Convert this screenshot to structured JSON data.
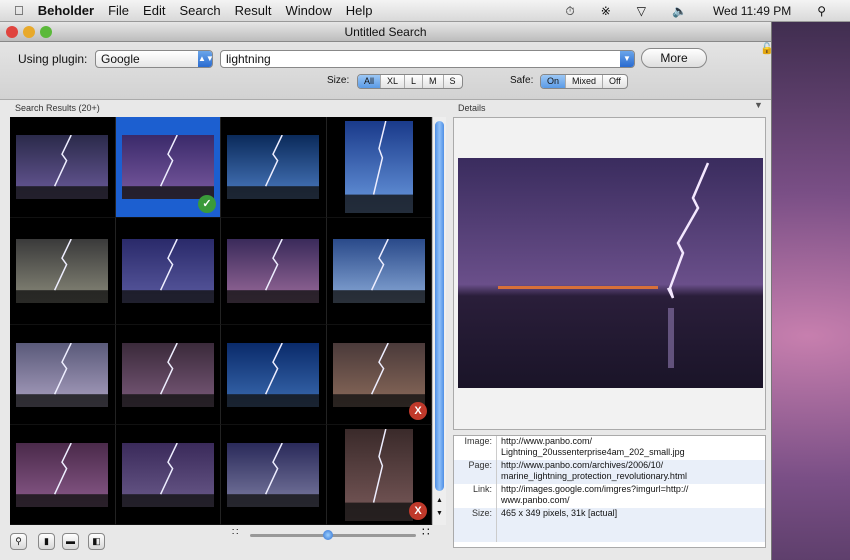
{
  "menubar": {
    "app": "Beholder",
    "items": [
      "File",
      "Edit",
      "Search",
      "Result",
      "Window",
      "Help"
    ],
    "clock": "Wed 11:49 PM"
  },
  "window": {
    "title": "Untitled Search"
  },
  "toolbar": {
    "plugin_label": "Using plugin:",
    "plugin_value": "Google",
    "query": "lightning",
    "more_label": "More",
    "size_label": "Size:",
    "size_options": [
      "All",
      "XL",
      "L",
      "M",
      "S"
    ],
    "size_selected": "All",
    "safe_label": "Safe:",
    "safe_options": [
      "On",
      "Mixed",
      "Off"
    ],
    "safe_selected": "On"
  },
  "results": {
    "header": "Search Results (20+)",
    "selected_index": 1,
    "thumbs": [
      {
        "status": ""
      },
      {
        "status": "accepted"
      },
      {
        "status": ""
      },
      {
        "status": ""
      },
      {
        "status": ""
      },
      {
        "status": ""
      },
      {
        "status": ""
      },
      {
        "status": ""
      },
      {
        "status": ""
      },
      {
        "status": ""
      },
      {
        "status": ""
      },
      {
        "status": "rejected"
      },
      {
        "status": ""
      },
      {
        "status": ""
      },
      {
        "status": ""
      },
      {
        "status": "rejected"
      }
    ],
    "zoom_slider": 0.47
  },
  "details": {
    "header": "Details",
    "rows": [
      {
        "key": "Image:",
        "value": "http://www.panbo.com/ Lightning_20ussenterprise4am_202_small.jpg"
      },
      {
        "key": "Page:",
        "value": "http://www.panbo.com/archives/2006/10/ marine_lightning_protection_revolutionary.html"
      },
      {
        "key": "Link:",
        "value": "http://images.google.com/imgres?imgurl=http:// www.panbo.com/"
      },
      {
        "key": "Size:",
        "value": "465 x 349 pixels, 31k [actual]"
      }
    ]
  },
  "icons": {
    "accepted": "checkmark-icon",
    "rejected": "x-icon"
  },
  "colors": {
    "accent": "#2a6bd0",
    "accepted": "#3a9a3a",
    "rejected": "#c0392b"
  }
}
